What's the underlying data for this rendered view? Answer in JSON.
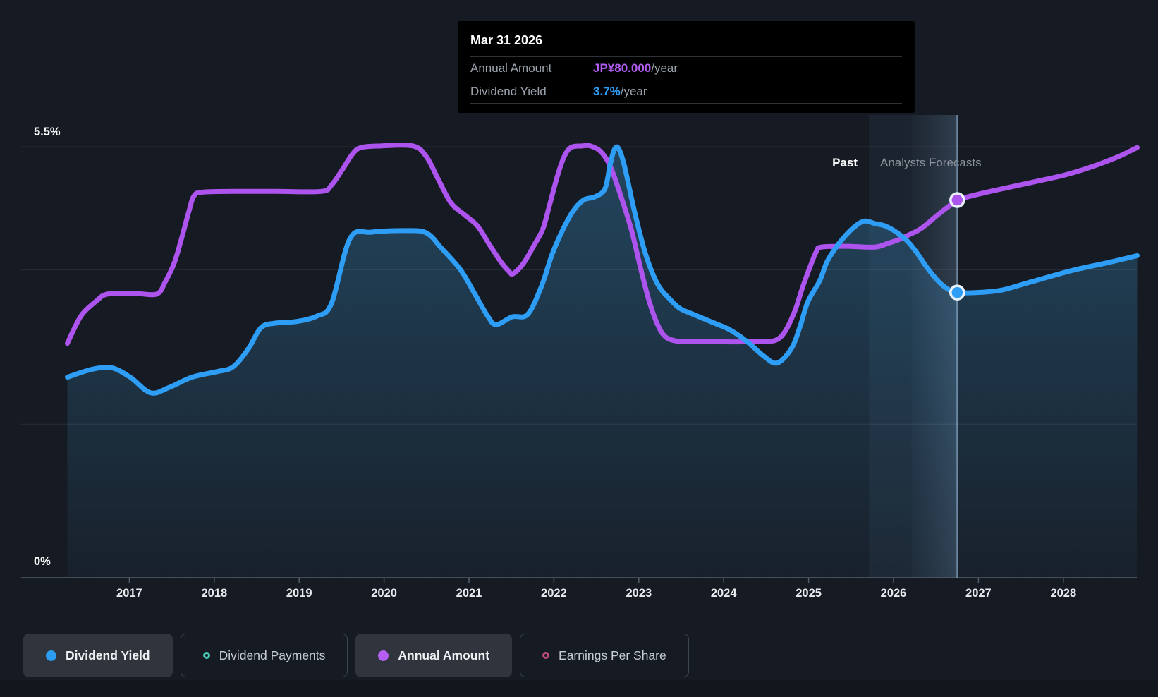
{
  "tooltip": {
    "date": "Mar 31 2026",
    "rows": [
      {
        "label": "Annual Amount",
        "value": "JP¥80.000",
        "suffix": "/year",
        "color": "#b05df0"
      },
      {
        "label": "Dividend Yield",
        "value": "3.7%",
        "suffix": "/year",
        "color": "#2e9df5"
      }
    ]
  },
  "annotations": {
    "past_label": "Past",
    "forecast_label": "Analysts Forecasts"
  },
  "legend": [
    {
      "label": "Dividend Yield",
      "marker": "filled",
      "color": "#2b9cf0",
      "active": true
    },
    {
      "label": "Dividend Payments",
      "marker": "outline",
      "color": "#46c8b4",
      "active": false
    },
    {
      "label": "Annual Amount",
      "marker": "filled",
      "color": "#b45ef2",
      "active": true
    },
    {
      "label": "Earnings Per Share",
      "marker": "outline",
      "color": "#bb4980",
      "active": false
    }
  ],
  "chart_data": {
    "type": "line",
    "title": "Dividend history and forecast",
    "x_ticks": [
      2017,
      2018,
      2019,
      2020,
      2021,
      2022,
      2023,
      2024,
      2025,
      2026,
      2027,
      2028
    ],
    "x_range": [
      2016.27,
      2028.87
    ],
    "y_axis": {
      "top_label": "5.5%",
      "bottom_label": "0%",
      "ylim": [
        0,
        5.5
      ],
      "gridline_values": [
        5.5,
        3.93,
        1.96,
        0
      ]
    },
    "past_forecast_divider_year": 2025.72,
    "hover": {
      "date_label": "Mar 31 2026",
      "x_year": 2026.75,
      "band_start_year": 2026.21,
      "region_start_year": 2025.72
    },
    "series": [
      {
        "name": "Dividend Yield",
        "unit": "% per year (left axis)",
        "color": "#2e9df5",
        "area": true,
        "points": [
          [
            2016.27,
            2.56
          ],
          [
            2016.56,
            2.66
          ],
          [
            2016.79,
            2.68
          ],
          [
            2017.01,
            2.56
          ],
          [
            2017.25,
            2.36
          ],
          [
            2017.47,
            2.43
          ],
          [
            2017.74,
            2.56
          ],
          [
            2018.03,
            2.63
          ],
          [
            2018.22,
            2.69
          ],
          [
            2018.4,
            2.92
          ],
          [
            2018.55,
            3.19
          ],
          [
            2018.72,
            3.25
          ],
          [
            2018.97,
            3.27
          ],
          [
            2019.21,
            3.34
          ],
          [
            2019.38,
            3.5
          ],
          [
            2019.6,
            4.33
          ],
          [
            2019.85,
            4.41
          ],
          [
            2020.25,
            4.43
          ],
          [
            2020.5,
            4.4
          ],
          [
            2020.68,
            4.2
          ],
          [
            2020.9,
            3.93
          ],
          [
            2021.07,
            3.62
          ],
          [
            2021.22,
            3.34
          ],
          [
            2021.32,
            3.23
          ],
          [
            2021.51,
            3.33
          ],
          [
            2021.69,
            3.36
          ],
          [
            2021.85,
            3.71
          ],
          [
            2021.98,
            4.13
          ],
          [
            2022.1,
            4.43
          ],
          [
            2022.22,
            4.67
          ],
          [
            2022.35,
            4.82
          ],
          [
            2022.48,
            4.86
          ],
          [
            2022.6,
            4.96
          ],
          [
            2022.66,
            5.26
          ],
          [
            2022.71,
            5.46
          ],
          [
            2022.76,
            5.48
          ],
          [
            2022.83,
            5.26
          ],
          [
            2022.95,
            4.67
          ],
          [
            2023.08,
            4.13
          ],
          [
            2023.22,
            3.75
          ],
          [
            2023.37,
            3.55
          ],
          [
            2023.48,
            3.44
          ],
          [
            2023.6,
            3.38
          ],
          [
            2023.89,
            3.25
          ],
          [
            2024.08,
            3.16
          ],
          [
            2024.28,
            3.01
          ],
          [
            2024.47,
            2.83
          ],
          [
            2024.63,
            2.74
          ],
          [
            2024.8,
            2.93
          ],
          [
            2024.9,
            3.21
          ],
          [
            2024.99,
            3.52
          ],
          [
            2025.13,
            3.79
          ],
          [
            2025.22,
            4.04
          ],
          [
            2025.36,
            4.27
          ],
          [
            2025.51,
            4.45
          ],
          [
            2025.65,
            4.55
          ],
          [
            2025.78,
            4.52
          ],
          [
            2025.9,
            4.49
          ],
          [
            2026.02,
            4.42
          ],
          [
            2026.15,
            4.31
          ],
          [
            2026.26,
            4.17
          ],
          [
            2026.4,
            3.95
          ],
          [
            2026.54,
            3.77
          ],
          [
            2026.66,
            3.67
          ],
          [
            2026.75,
            3.64
          ],
          [
            2026.98,
            3.64
          ],
          [
            2027.27,
            3.67
          ],
          [
            2027.6,
            3.77
          ],
          [
            2028.1,
            3.92
          ],
          [
            2028.52,
            4.02
          ],
          [
            2028.87,
            4.11
          ]
        ]
      },
      {
        "name": "Annual Amount",
        "unit": "JP¥ per year (hidden right axis, values shown on left-axis scale)",
        "color": "#ad53ee",
        "area": false,
        "points": [
          [
            2016.27,
            2.99
          ],
          [
            2016.36,
            3.2
          ],
          [
            2016.45,
            3.37
          ],
          [
            2016.61,
            3.53
          ],
          [
            2016.74,
            3.62
          ],
          [
            2017.05,
            3.63
          ],
          [
            2017.32,
            3.62
          ],
          [
            2017.42,
            3.77
          ],
          [
            2017.53,
            4.02
          ],
          [
            2017.61,
            4.31
          ],
          [
            2017.7,
            4.67
          ],
          [
            2017.76,
            4.87
          ],
          [
            2017.86,
            4.92
          ],
          [
            2018.22,
            4.93
          ],
          [
            2018.72,
            4.93
          ],
          [
            2019.26,
            4.93
          ],
          [
            2019.38,
            5.01
          ],
          [
            2019.51,
            5.21
          ],
          [
            2019.63,
            5.41
          ],
          [
            2019.73,
            5.49
          ],
          [
            2019.96,
            5.51
          ],
          [
            2020.34,
            5.51
          ],
          [
            2020.5,
            5.37
          ],
          [
            2020.64,
            5.08
          ],
          [
            2020.79,
            4.78
          ],
          [
            2020.95,
            4.63
          ],
          [
            2021.1,
            4.49
          ],
          [
            2021.23,
            4.27
          ],
          [
            2021.37,
            4.04
          ],
          [
            2021.47,
            3.91
          ],
          [
            2021.52,
            3.88
          ],
          [
            2021.64,
            4.01
          ],
          [
            2021.77,
            4.25
          ],
          [
            2021.87,
            4.45
          ],
          [
            2021.95,
            4.76
          ],
          [
            2022.04,
            5.12
          ],
          [
            2022.12,
            5.37
          ],
          [
            2022.2,
            5.49
          ],
          [
            2022.33,
            5.51
          ],
          [
            2022.43,
            5.51
          ],
          [
            2022.55,
            5.44
          ],
          [
            2022.66,
            5.26
          ],
          [
            2022.78,
            4.9
          ],
          [
            2022.91,
            4.45
          ],
          [
            2023.03,
            3.91
          ],
          [
            2023.13,
            3.5
          ],
          [
            2023.23,
            3.21
          ],
          [
            2023.32,
            3.07
          ],
          [
            2023.45,
            3.02
          ],
          [
            2023.6,
            3.02
          ],
          [
            2024.11,
            3.01
          ],
          [
            2024.45,
            3.02
          ],
          [
            2024.61,
            3.03
          ],
          [
            2024.72,
            3.14
          ],
          [
            2024.84,
            3.41
          ],
          [
            2024.92,
            3.68
          ],
          [
            2025.0,
            3.92
          ],
          [
            2025.09,
            4.16
          ],
          [
            2025.15,
            4.22
          ],
          [
            2025.44,
            4.23
          ],
          [
            2025.78,
            4.22
          ],
          [
            2025.94,
            4.27
          ],
          [
            2026.05,
            4.31
          ],
          [
            2026.19,
            4.38
          ],
          [
            2026.33,
            4.46
          ],
          [
            2026.52,
            4.63
          ],
          [
            2026.65,
            4.74
          ],
          [
            2026.75,
            4.82
          ],
          [
            2027.02,
            4.9
          ],
          [
            2027.35,
            4.98
          ],
          [
            2027.69,
            5.06
          ],
          [
            2028.02,
            5.14
          ],
          [
            2028.35,
            5.25
          ],
          [
            2028.64,
            5.37
          ],
          [
            2028.87,
            5.49
          ]
        ]
      }
    ],
    "markers": [
      {
        "series": "Annual Amount",
        "year": 2026.75,
        "value": 4.82,
        "label": "JP¥80.000/year"
      },
      {
        "series": "Dividend Yield",
        "year": 2026.75,
        "value": 3.64,
        "label": "3.7%/year"
      }
    ],
    "colors": {
      "background": "#161b23",
      "gridline": "rgba(255,255,255,0.08)",
      "axis_line": "#555e68",
      "tick_label": "#e8ebee",
      "area_fill_top": "rgba(56,140,192,0.38)",
      "area_fill_bottom": "rgba(56,140,192,0.05)",
      "hover_line": "rgba(166,203,238,0.55)",
      "forecast_band": "rgba(98,150,200,0.07)",
      "hover_band_from": "rgba(120,175,225,0.08)",
      "hover_band_to": "rgba(150,200,245,0.20)"
    },
    "legend_position": "bottom",
    "grid": true
  }
}
